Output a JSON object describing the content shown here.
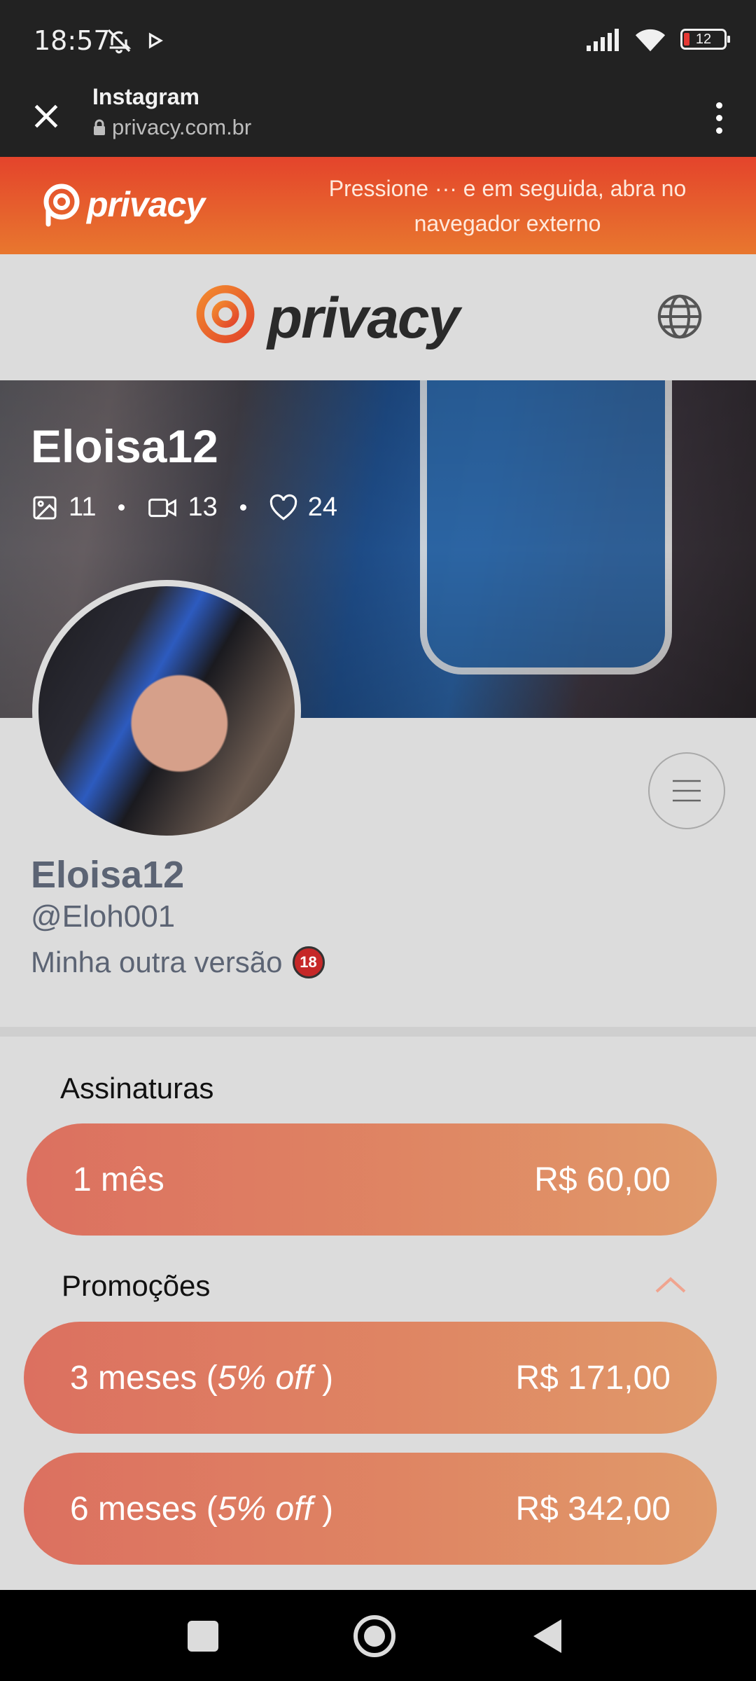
{
  "status_bar": {
    "time": "18:57",
    "battery": "12"
  },
  "browser": {
    "title": "Instagram",
    "url": "privacy.com.br"
  },
  "banner": {
    "logo_text": "privacy",
    "message": "Pressione ··· e em seguida, abra no navegador externo"
  },
  "header": {
    "logo_text": "privacy"
  },
  "cover": {
    "name": "Eloisa12",
    "photos": "11",
    "videos": "13",
    "likes": "24"
  },
  "profile": {
    "name": "Eloisa12",
    "handle": "@Eloh001",
    "bio": "Minha outra versão",
    "bio_badge": "18"
  },
  "subscriptions": {
    "title": "Assinaturas",
    "plans": [
      {
        "label": "1 mês",
        "price": "R$ 60,00"
      }
    ]
  },
  "promotions": {
    "title": "Promoções",
    "plans": [
      {
        "label": "3 meses (",
        "off": "5% off",
        "close": " )",
        "price": "R$ 171,00"
      },
      {
        "label": "6 meses (",
        "off": "5% off",
        "close": " )",
        "price": "R$ 342,00"
      }
    ]
  },
  "colors": {
    "accent": "#e4442c",
    "plan_start": "#dc7060",
    "plan_end": "#e09a6a",
    "text_muted": "#5c6474"
  }
}
